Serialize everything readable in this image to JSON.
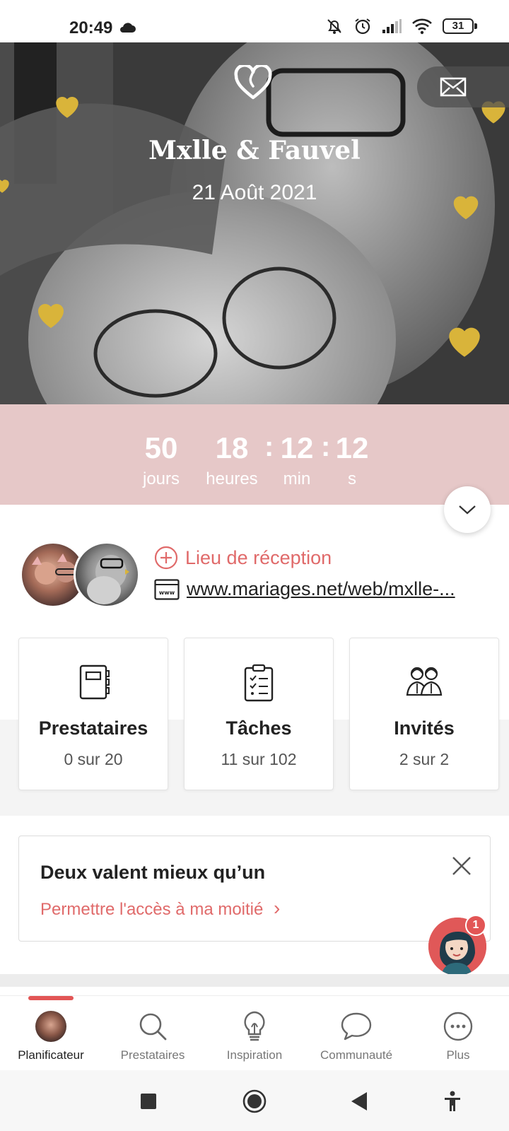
{
  "status_bar": {
    "time": "20:49",
    "battery": "31"
  },
  "hero": {
    "names": "Mxlle & Fauvel",
    "date": "21 Août 2021"
  },
  "countdown": {
    "days": "50",
    "days_label": "jours",
    "hours": "18",
    "hours_label": "heures",
    "minutes": "12",
    "minutes_label": "min",
    "seconds": "12",
    "seconds_label": "s",
    "separator": ":"
  },
  "couple": {
    "venue_label": "Lieu de réception",
    "website": "www.mariages.net/web/mxlle-...",
    "website_icon_text": "www"
  },
  "stats": [
    {
      "title": "Prestataires",
      "sub": "0 sur 20",
      "icon": "notebook-icon"
    },
    {
      "title": "Tâches",
      "sub": "11 sur 102",
      "icon": "checklist-icon"
    },
    {
      "title": "Invités",
      "sub": "2 sur 2",
      "icon": "guests-icon"
    }
  ],
  "share": {
    "title": "Deux valent mieux qu’un",
    "link": "Permettre l'accès à ma moitié",
    "chevron": "›"
  },
  "assistant": {
    "badge": "1"
  },
  "bottom_nav": [
    {
      "label": "Planificateur",
      "icon": "avatar-icon",
      "active": true
    },
    {
      "label": "Prestataires",
      "icon": "search-icon",
      "active": false
    },
    {
      "label": "Inspiration",
      "icon": "lightbulb-icon",
      "active": false
    },
    {
      "label": "Communauté",
      "icon": "chat-bubble-icon",
      "active": false
    },
    {
      "label": "Plus",
      "icon": "more-icon",
      "active": false
    }
  ],
  "colors": {
    "accent": "#e06a6a",
    "countdown_bg": "#e6c8c8",
    "gold": "#d9b43a"
  }
}
